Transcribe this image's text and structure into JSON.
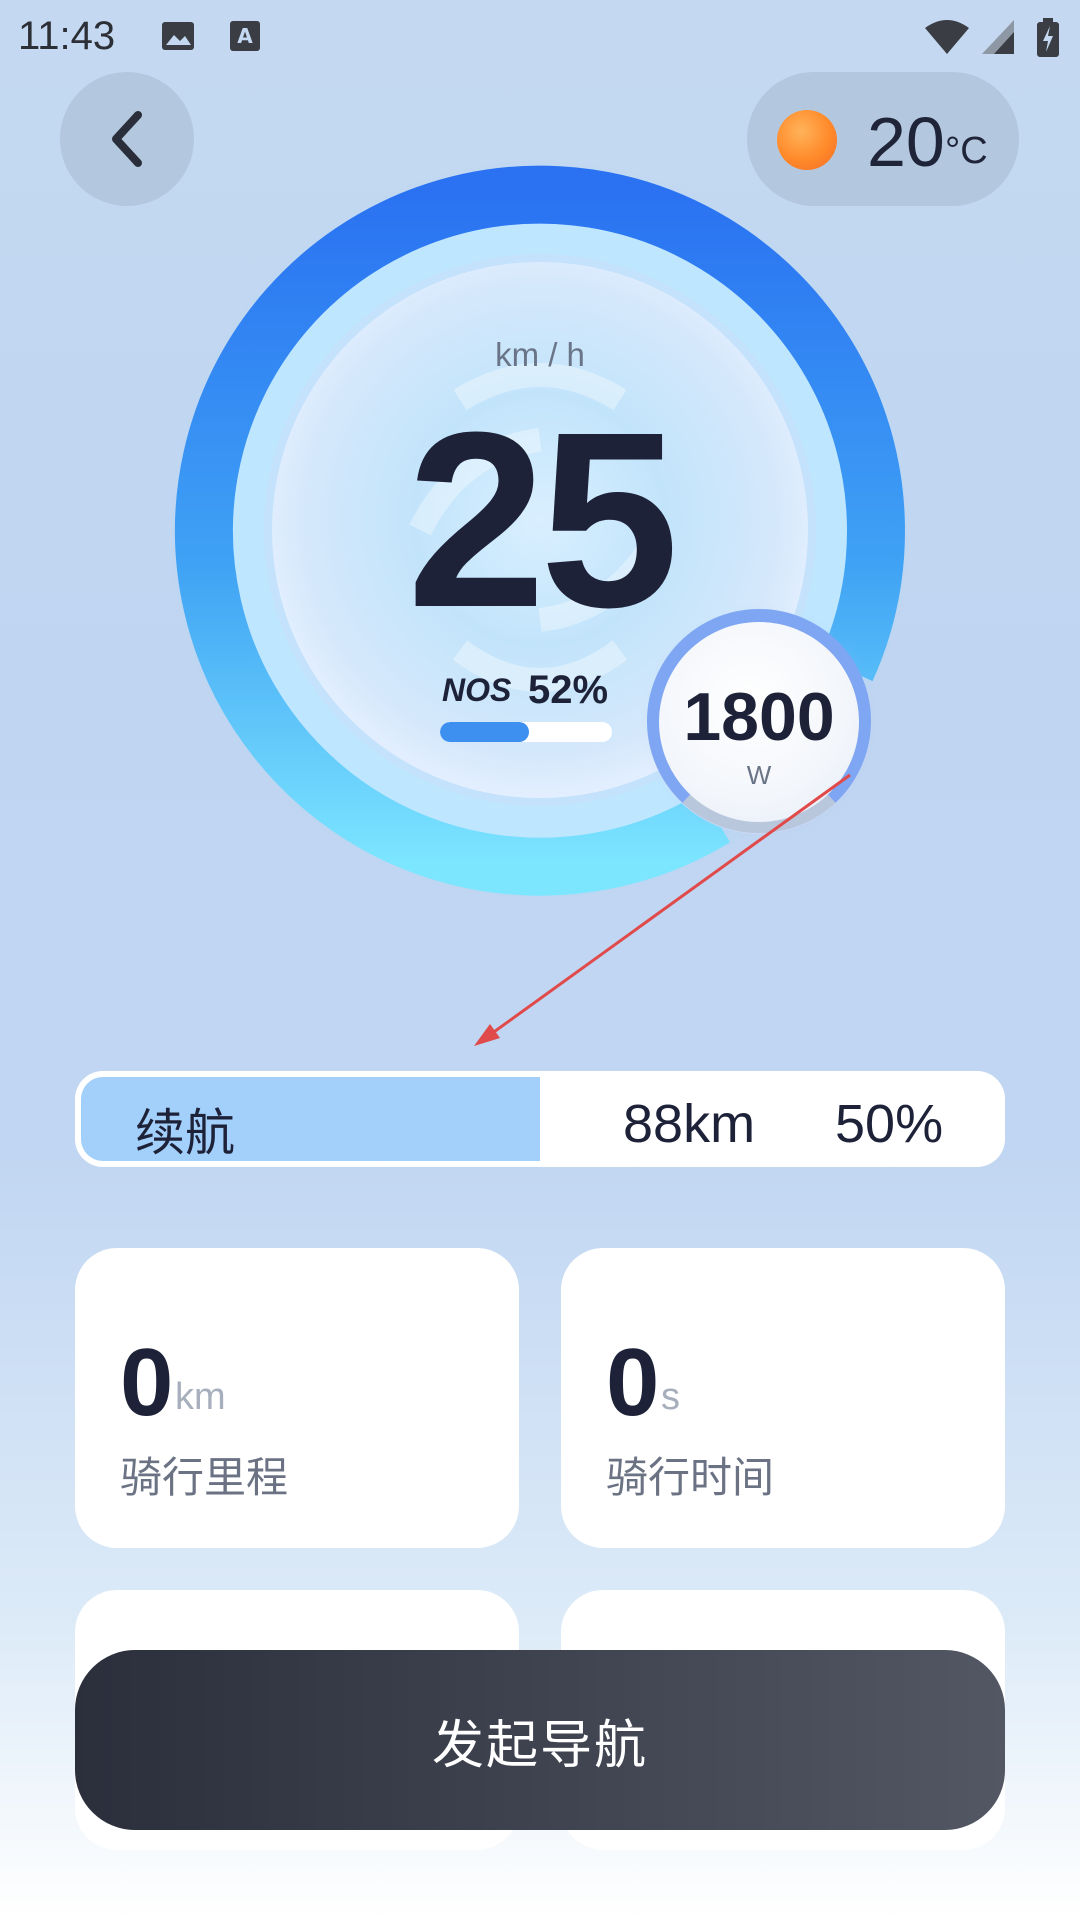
{
  "status_bar": {
    "time": "11:43"
  },
  "weather": {
    "temperature": "20",
    "unit": "°C",
    "icon": "sun-icon"
  },
  "speedometer": {
    "unit": "km / h",
    "speed": "25",
    "nos_label": "NOS",
    "nos_value": "52%",
    "nos_fraction": 0.52
  },
  "power": {
    "value": "1800",
    "unit": "W"
  },
  "range": {
    "label": "续航",
    "distance": "88km",
    "percent": "50%",
    "fraction": 0.5
  },
  "stats": [
    {
      "value": "0",
      "unit": "km",
      "label": "骑行里程"
    },
    {
      "value": "0",
      "unit": "s",
      "label": "骑行时间"
    }
  ],
  "nav_button": {
    "label": "发起导航"
  },
  "colors": {
    "accent": "#2f7ff2",
    "range_fill": "#a3cffb",
    "nav_button": "#3a3e4a",
    "annotation": "#e04a4a"
  }
}
